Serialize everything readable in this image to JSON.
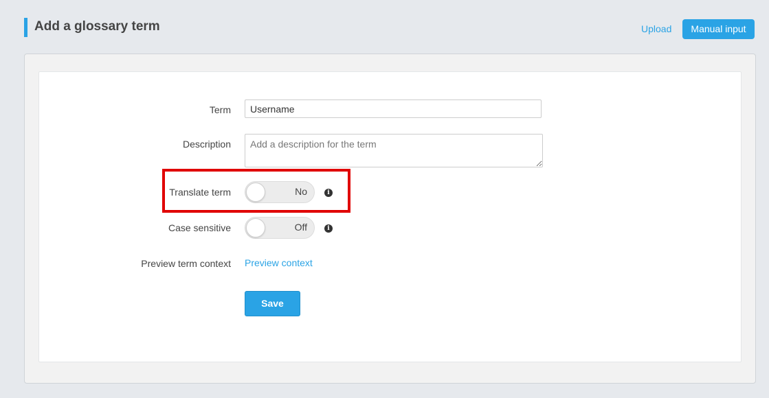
{
  "header": {
    "title": "Add a glossary term",
    "upload_label": "Upload",
    "manual_input_label": "Manual input"
  },
  "form": {
    "term": {
      "label": "Term",
      "value": "Username"
    },
    "description": {
      "label": "Description",
      "value": "",
      "placeholder": "Add a description for the term"
    },
    "translate_term": {
      "label": "Translate term",
      "state_text": "No",
      "on": false
    },
    "case_sensitive": {
      "label": "Case sensitive",
      "state_text": "Off",
      "on": false
    },
    "preview_context": {
      "label": "Preview term context",
      "link_text": "Preview context"
    },
    "save_label": "Save"
  },
  "icons": {
    "info": "info-icon"
  },
  "colors": {
    "accent": "#2aa3e5",
    "highlight": "#e00000",
    "background": "#e6e9ed"
  }
}
